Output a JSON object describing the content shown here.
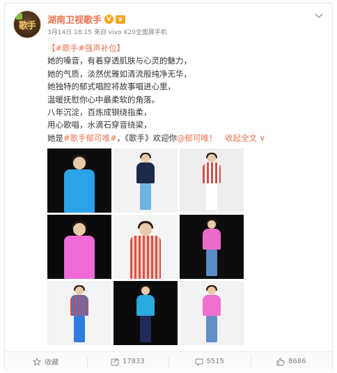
{
  "post": {
    "author": "湖南卫视歌手",
    "verified_mark": "V",
    "member_mark": "♛",
    "avatar_text": "歌手",
    "meta": "3月14日 18:15 来自 vivo X20全面屏手机",
    "tag_title": "【#歌手#强声补位】",
    "lines": [
      "她的嗓音，有着穿透肌肤与心灵的魅力，",
      "她的气质，淡然优雅如清流般纯净无华，",
      "她独特的郁式唱腔将故事唱进心里，",
      "温暖抚慰你心中最柔软的角落。",
      "八年沉淀，百炼成钢绕指柔，",
      "用心歌唱，水滴石穿音绕梁，"
    ],
    "last_line": {
      "prefix": "她是",
      "hashtag": "#歌手郁可唯#",
      "middle": "，《歌手》欢迎你",
      "mention": "@郁可唯",
      "expand": "！　收起全文 ∨"
    }
  },
  "photos": [
    {
      "bg": "#0c0c0c",
      "fig": "#2aa3e8",
      "accent": "#1a1a6e"
    },
    {
      "bg": "#f2f2f2",
      "fig": "#1c2a4a",
      "accent": "#6fb3e0"
    },
    {
      "bg": "#eeeeee",
      "fig": "#d94a4a",
      "accent": "#ffffff"
    },
    {
      "bg": "#0a0a0a",
      "fig": "#f06ad8",
      "accent": "#4a7ab8"
    },
    {
      "bg": "#f4f4f4",
      "fig": "#d8524a",
      "accent": "#f5d0c0"
    },
    {
      "bg": "#0d0d0d",
      "fig": "#ee6ac8",
      "accent": "#5a8ac8"
    },
    {
      "bg": "#f3f3f3",
      "fig": "#d84b4b",
      "accent": "#2f7de0"
    },
    {
      "bg": "#0b0b0b",
      "fig": "#2aa8e0",
      "accent": "#1e2a5a"
    },
    {
      "bg": "#f2f2f2",
      "fig": "#f070d0",
      "accent": "#5f8ec8"
    }
  ],
  "footer": {
    "favorite_label": "收藏",
    "repost_count": "17833",
    "comment_count": "5515",
    "like_count": "8686"
  },
  "colors": {
    "link": "#eb7350",
    "meta_gray": "#808080",
    "verified": "#ffa200"
  },
  "icons": {
    "favorite": "star-icon",
    "repost": "share-icon",
    "comment": "comment-icon",
    "like": "thumbs-up-icon",
    "more": "chevron-down-icon"
  }
}
